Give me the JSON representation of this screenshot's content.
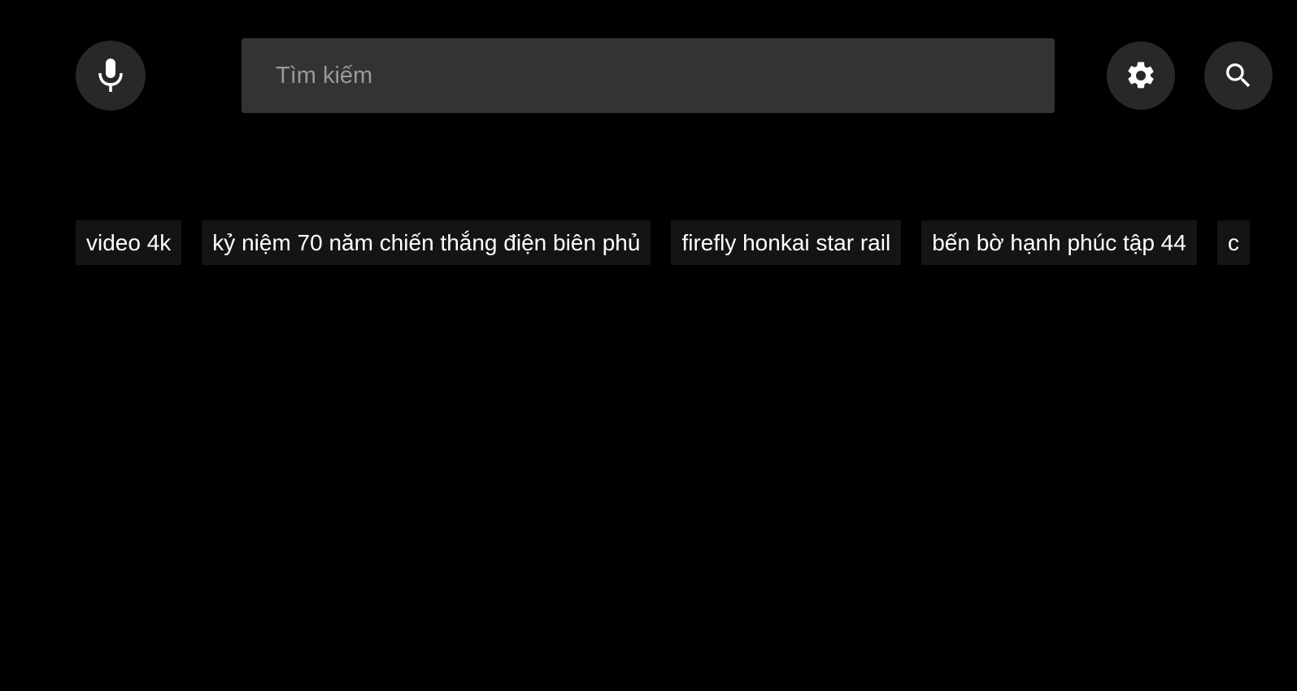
{
  "toolbar": {
    "mic_icon": "microphone-icon",
    "settings_icon": "gear-icon",
    "search_icon": "search-icon"
  },
  "search": {
    "placeholder": "Tìm kiếm",
    "value": ""
  },
  "suggestions": [
    {
      "label": "video 4k"
    },
    {
      "label": "kỷ niệm 70 năm chiến thắng điện biên phủ"
    },
    {
      "label": "firefly honkai star rail"
    },
    {
      "label": "bến bờ hạnh phúc tập 44"
    },
    {
      "label": "c"
    }
  ],
  "colors": {
    "background": "#000000",
    "search_box": "#333333",
    "round_button": "#282828",
    "chip_background": "#141414",
    "text": "#ffffff",
    "placeholder": "#9a9a9a"
  }
}
